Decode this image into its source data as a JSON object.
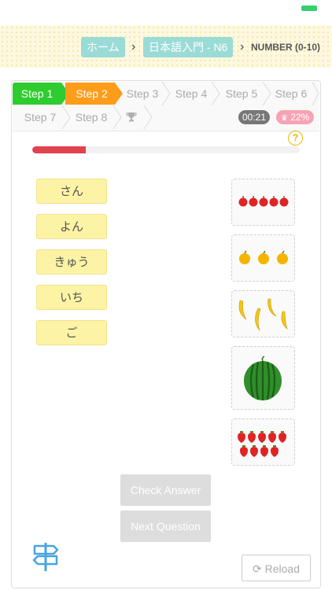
{
  "breadcrumb": {
    "home": "ホーム",
    "course": "日本語入門 - N6",
    "separator": "›",
    "current": "NUMBER (0-10)"
  },
  "steps": [
    {
      "label": "Step 1",
      "state": "done"
    },
    {
      "label": "Step 2",
      "state": "current"
    },
    {
      "label": "Step 3",
      "state": "todo"
    },
    {
      "label": "Step 4",
      "state": "todo"
    },
    {
      "label": "Step 5",
      "state": "todo"
    },
    {
      "label": "Step 6",
      "state": "todo"
    },
    {
      "label": "Step 7",
      "state": "todo"
    },
    {
      "label": "Step 8",
      "state": "todo"
    }
  ],
  "trophy_icon": "trophy-icon",
  "timer": "00:21",
  "score": "22%",
  "help": "?",
  "progress_fraction": 0.2,
  "words": [
    "さん",
    "よん",
    "きゅう",
    "いち",
    "ご"
  ],
  "pictures": [
    {
      "name": "five-apples",
      "fruit": "apple",
      "count": 5
    },
    {
      "name": "three-oranges",
      "fruit": "orange",
      "count": 3
    },
    {
      "name": "bananas",
      "fruit": "banana",
      "count": 4
    },
    {
      "name": "one-watermelon",
      "fruit": "watermelon",
      "count": 1
    },
    {
      "name": "nine-strawberries",
      "fruit": "strawberry",
      "count": 9
    }
  ],
  "buttons": {
    "check": "Check Answer",
    "next": "Next Question",
    "reload": "Reload"
  },
  "colors": {
    "step_done": "#2ecc2e",
    "step_current": "#ff9c1a",
    "progress": "#e0424e",
    "word_bg": "#fcf3a5",
    "crumb_button": "#9adbd6"
  }
}
